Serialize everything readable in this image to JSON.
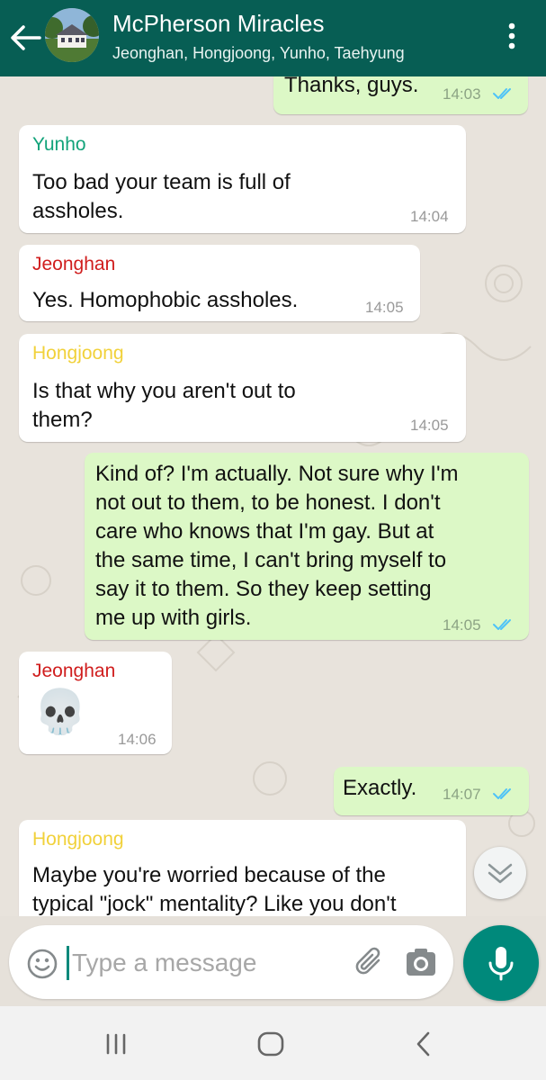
{
  "header": {
    "title": "McPherson Miracles",
    "members": "Jeonghan, Hongjoong, Yunho, Taehyung",
    "header_color": "#075e54"
  },
  "messages": [
    {
      "type": "outgoing",
      "text": "Thanks, guys.",
      "time": "14:03",
      "status": "read"
    },
    {
      "type": "incoming",
      "sender": "Yunho",
      "sender_color": "#12a37a",
      "text": "Too bad your team is full of\nassholes.",
      "time": "14:04"
    },
    {
      "type": "incoming",
      "sender": "Jeonghan",
      "sender_color": "#d01d1d",
      "text": "Yes. Homophobic assholes.",
      "time": "14:05"
    },
    {
      "type": "incoming",
      "sender": "Hongjoong",
      "sender_color": "#f1d13a",
      "text": "Is that why you aren't out to\nthem?",
      "time": "14:05"
    },
    {
      "type": "outgoing",
      "text": "Kind of? I'm actually. Not sure why I'm\nnot out to them, to be honest. I don't\ncare who knows that I'm gay. But at\nthe same time, I can't bring myself to\nsay it to them. So they keep setting\nme up with girls.",
      "time": "14:05",
      "status": "read"
    },
    {
      "type": "incoming",
      "sender": "Jeonghan",
      "sender_color": "#d01d1d",
      "text": "💀",
      "time": "14:06"
    },
    {
      "type": "outgoing",
      "text": "Exactly.",
      "time": "14:07",
      "status": "read"
    },
    {
      "type": "incoming",
      "sender": "Hongjoong",
      "sender_color": "#f1d13a",
      "text": "Maybe you're worried because of the\ntypical \"jock\" mentality? Like you don't",
      "time": ""
    }
  ],
  "composer": {
    "placeholder": "Type a message"
  },
  "icons": {
    "back": "arrow-left-icon",
    "menu": "more-vertical-icon",
    "scroll": "double-chevron-down-icon",
    "emoji": "smiley-icon",
    "attach": "paperclip-icon",
    "camera": "camera-icon",
    "mic": "microphone-icon"
  },
  "colors": {
    "outgoing_bubble": "#dcf8c6",
    "incoming_bubble": "#ffffff",
    "read_ticks": "#4fc3f7",
    "accent": "#00897b"
  }
}
